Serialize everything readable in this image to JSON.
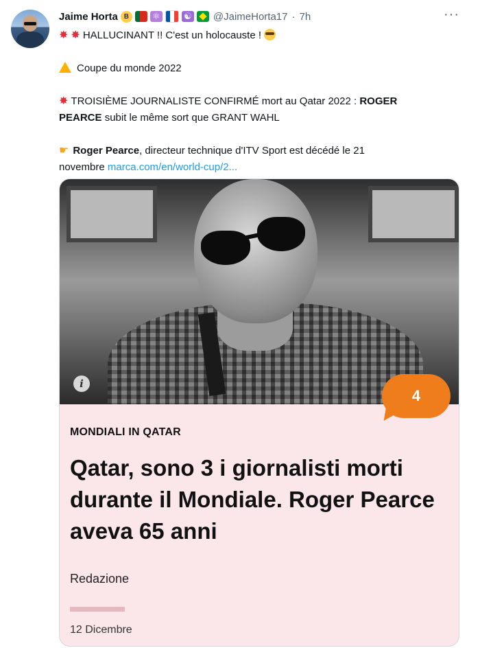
{
  "author": {
    "name": "Jaime Horta",
    "handle": "@JaimeHorta17",
    "time_separator": "·",
    "time": "7h",
    "avatar_icon": "profile-photo",
    "name_emojis": [
      "sunglasses-emoji",
      "portugal-flag-icon",
      "atom-icon",
      "france-flag-icon",
      "yin-yang-icon",
      "brazil-flag-icon"
    ]
  },
  "more_label": "···",
  "tweet": {
    "line1": "HALLUCINANT !! C'est un holocauste !",
    "line2": "Coupe du monde 2022",
    "line3_prefix": "TROISIÈME JOURNALISTE CONFIRMÉ mort au Qatar 2022 :",
    "line3_bold": "ROGER",
    "line4_bold": "PEARCE",
    "line4_rest": "subit le même sort que GRANT WAHL",
    "line5_bold": "Roger Pearce",
    "line5_rest": ", directeur technique d'ITV Sport est décédé le 21",
    "line6_prefix": "novembre",
    "link": "marca.com/en/world-cup/2..."
  },
  "card": {
    "comments_count": "4",
    "info_label": "i",
    "kicker": "MONDIALI IN QATAR",
    "headline": "Qatar, sono 3 i giornalisti morti durante il Mondiale. Roger Pearce aveva 65 anni",
    "author": "Redazione",
    "date": "12 Dicembre"
  },
  "colors": {
    "link": "#1d9bf0",
    "card_bg": "#fbe6ea",
    "bubble": "#ef7d1c",
    "handle": "#536471"
  }
}
